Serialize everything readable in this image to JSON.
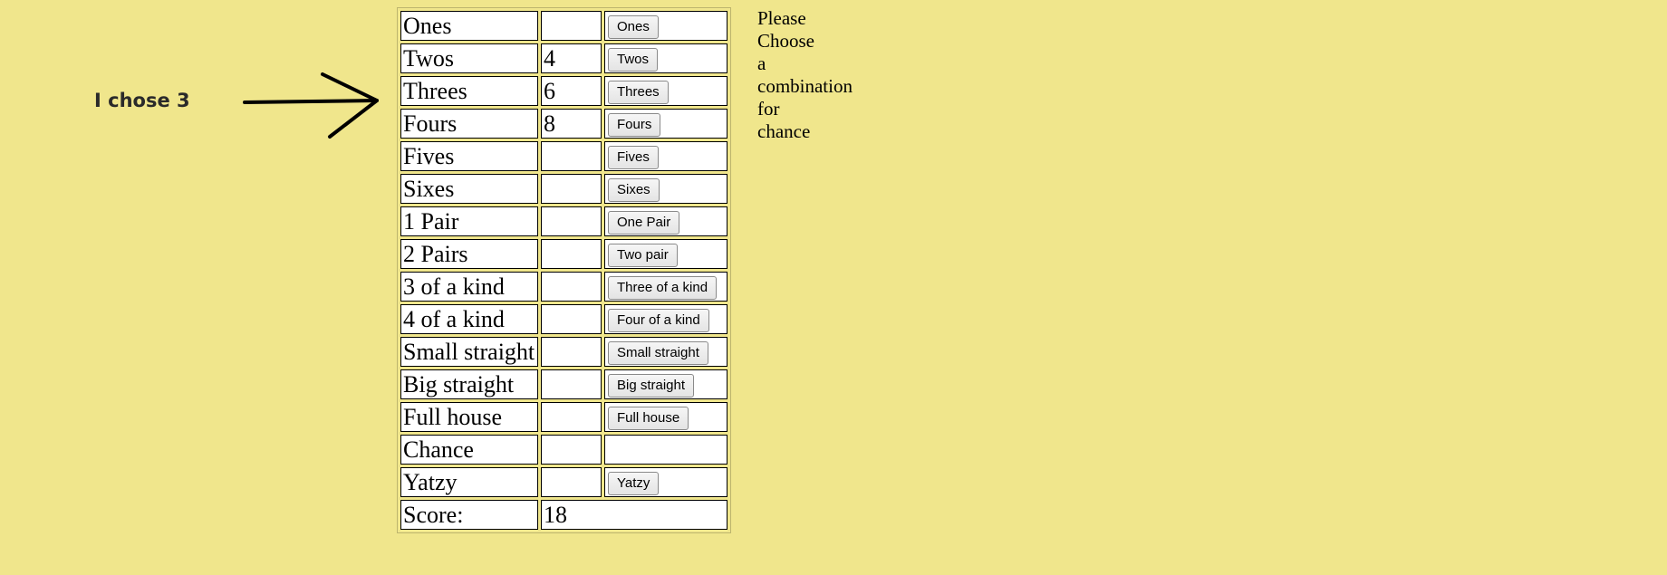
{
  "annotation": {
    "text": "I chose 3"
  },
  "rows": [
    {
      "name": "Ones",
      "value": "",
      "button": "Ones"
    },
    {
      "name": "Twos",
      "value": "4",
      "button": "Twos"
    },
    {
      "name": "Threes",
      "value": "6",
      "button": "Threes"
    },
    {
      "name": "Fours",
      "value": "8",
      "button": "Fours"
    },
    {
      "name": "Fives",
      "value": "",
      "button": "Fives"
    },
    {
      "name": "Sixes",
      "value": "",
      "button": "Sixes"
    },
    {
      "name": "1 Pair",
      "value": "",
      "button": "One Pair"
    },
    {
      "name": "2 Pairs",
      "value": "",
      "button": "Two pair"
    },
    {
      "name": "3 of a kind",
      "value": "",
      "button": "Three of a kind"
    },
    {
      "name": "4 of a kind",
      "value": "",
      "button": "Four of a kind"
    },
    {
      "name": "Small straight",
      "value": "",
      "button": "Small straight"
    },
    {
      "name": "Big straight",
      "value": "",
      "button": "Big straight"
    },
    {
      "name": "Full house",
      "value": "",
      "button": "Full house"
    },
    {
      "name": "Chance",
      "value": "",
      "button": ""
    },
    {
      "name": "Yatzy",
      "value": "",
      "button": "Yatzy"
    }
  ],
  "score": {
    "label": "Score:",
    "value": "18"
  },
  "message": {
    "lines": [
      "Please",
      "Choose",
      "a",
      "combination",
      "for",
      "chance"
    ]
  },
  "colors": {
    "background": "#f0e68c"
  }
}
